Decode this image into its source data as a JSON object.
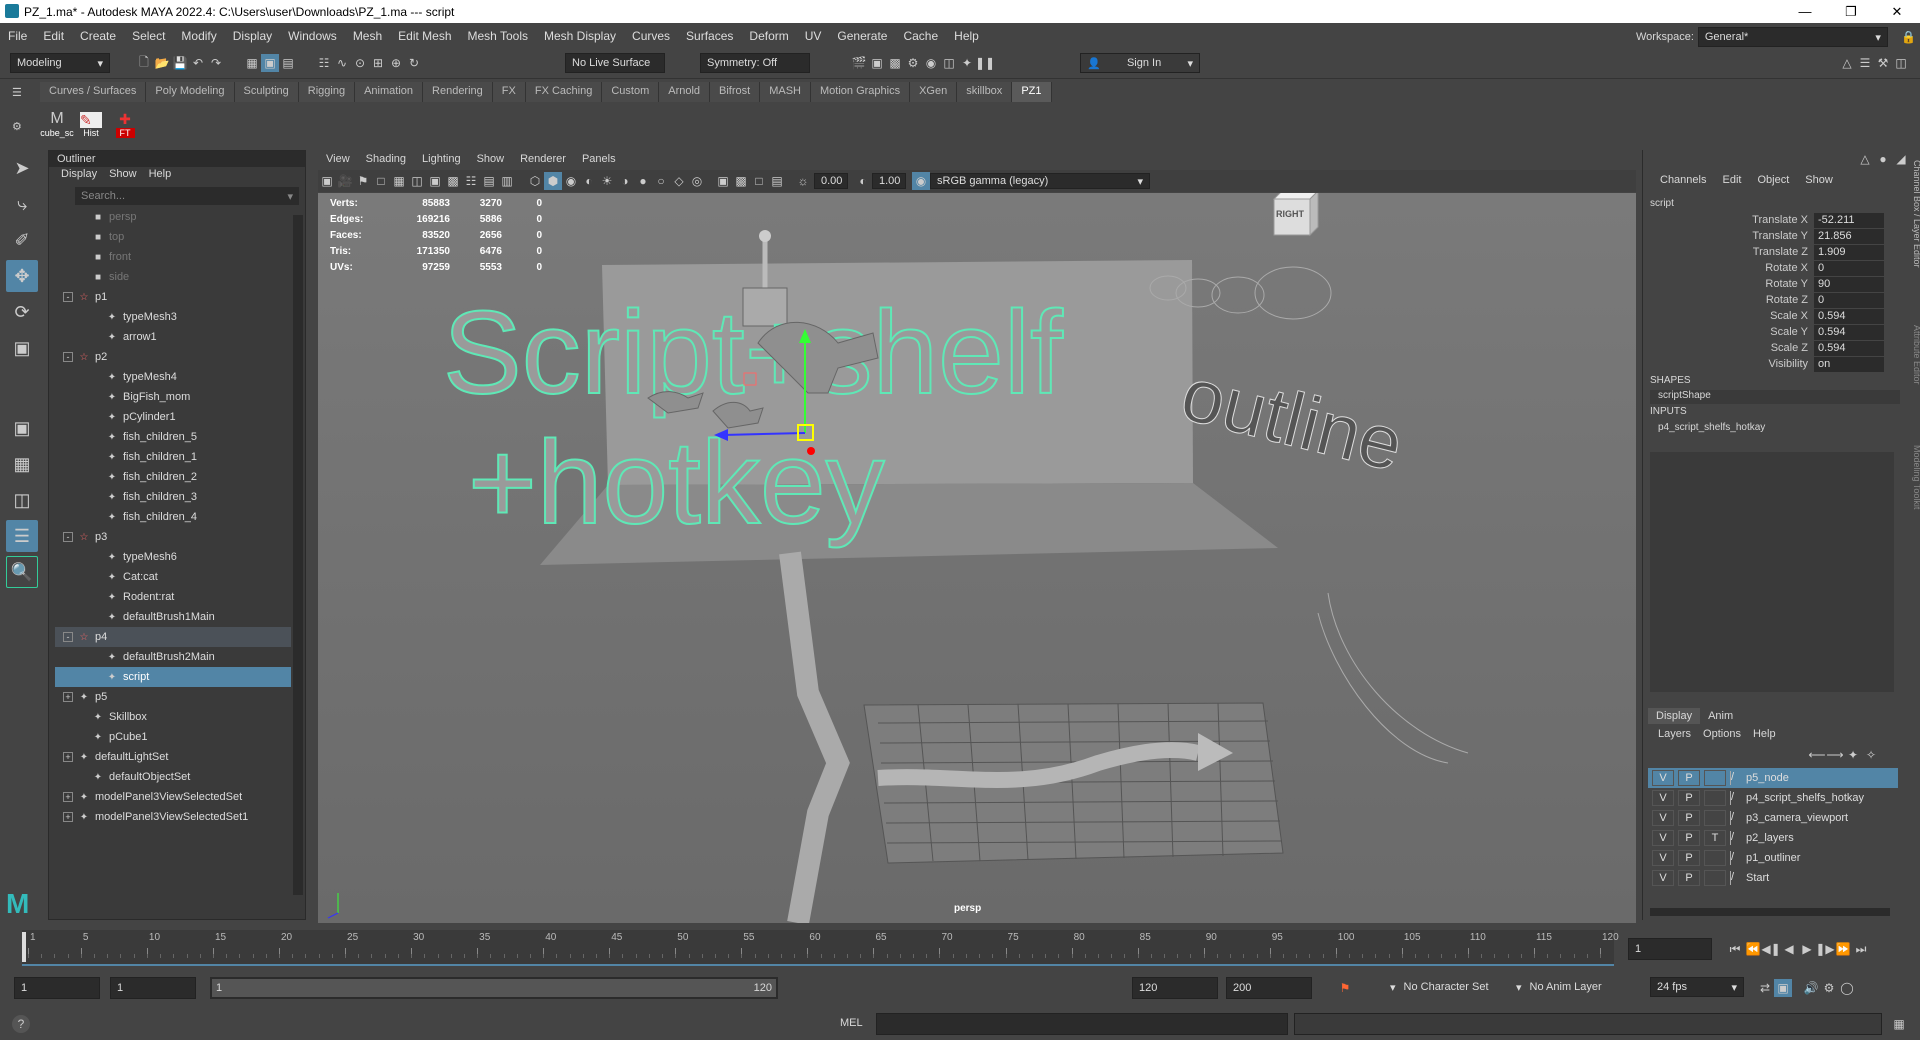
{
  "title": "PZ_1.ma* - Autodesk MAYA 2022.4: C:\\Users\\user\\Downloads\\PZ_1.ma  ---  script",
  "menus": [
    "File",
    "Edit",
    "Create",
    "Select",
    "Modify",
    "Display",
    "Windows",
    "Mesh",
    "Edit Mesh",
    "Mesh Tools",
    "Mesh Display",
    "Curves",
    "Surfaces",
    "Deform",
    "UV",
    "Generate",
    "Cache",
    "Help"
  ],
  "workspace_label": "Workspace:",
  "workspace_value": "General*",
  "status": {
    "mode": "Modeling",
    "live_surface": "No Live Surface",
    "symmetry": "Symmetry: Off",
    "sign_in": "Sign In"
  },
  "shelf_tabs": [
    "Curves / Surfaces",
    "Poly Modeling",
    "Sculpting",
    "Rigging",
    "Animation",
    "Rendering",
    "FX",
    "FX Caching",
    "Custom",
    "Arnold",
    "Bifrost",
    "MASH",
    "Motion Graphics",
    "XGen",
    "skillbox",
    "PZ1"
  ],
  "shelf_icons": [
    "cube_sc",
    "Hist",
    "FT"
  ],
  "outliner": {
    "title": "Outliner",
    "menu": [
      "Display",
      "Show",
      "Help"
    ],
    "search": "Search...",
    "items": [
      {
        "label": "persp",
        "indent": 1,
        "dim": true
      },
      {
        "label": "top",
        "indent": 1,
        "dim": true
      },
      {
        "label": "front",
        "indent": 1,
        "dim": true
      },
      {
        "label": "side",
        "indent": 1,
        "dim": true
      },
      {
        "label": "p1",
        "indent": 0,
        "exp": "-"
      },
      {
        "label": "typeMesh3",
        "indent": 2
      },
      {
        "label": "arrow1",
        "indent": 2
      },
      {
        "label": "p2",
        "indent": 0,
        "exp": "-"
      },
      {
        "label": "typeMesh4",
        "indent": 2
      },
      {
        "label": "BigFish_mom",
        "indent": 2
      },
      {
        "label": "pCylinder1",
        "indent": 2
      },
      {
        "label": "fish_children_5",
        "indent": 2
      },
      {
        "label": "fish_children_1",
        "indent": 2
      },
      {
        "label": "fish_children_2",
        "indent": 2
      },
      {
        "label": "fish_children_3",
        "indent": 2
      },
      {
        "label": "fish_children_4",
        "indent": 2
      },
      {
        "label": "p3",
        "indent": 0,
        "exp": "-"
      },
      {
        "label": "typeMesh6",
        "indent": 2
      },
      {
        "label": "Cat:cat",
        "indent": 2
      },
      {
        "label": "Rodent:rat",
        "indent": 2
      },
      {
        "label": "defaultBrush1Main",
        "indent": 2
      },
      {
        "label": "p4",
        "indent": 0,
        "exp": "-",
        "par": true
      },
      {
        "label": "defaultBrush2Main",
        "indent": 2
      },
      {
        "label": "script",
        "indent": 2,
        "sel": true
      },
      {
        "label": "p5",
        "indent": 0,
        "exp": "+"
      },
      {
        "label": "Skillbox",
        "indent": 1
      },
      {
        "label": "pCube1",
        "indent": 1
      },
      {
        "label": "defaultLightSet",
        "indent": 0,
        "exp": "+"
      },
      {
        "label": "defaultObjectSet",
        "indent": 1
      },
      {
        "label": "modelPanel3ViewSelectedSet",
        "indent": 0,
        "exp": "+"
      },
      {
        "label": "modelPanel3ViewSelectedSet1",
        "indent": 0,
        "exp": "+"
      }
    ]
  },
  "viewport": {
    "menu": [
      "View",
      "Shading",
      "Lighting",
      "Show",
      "Renderer",
      "Panels"
    ],
    "exposure": "0.00",
    "gamma": "1.00",
    "colorspace": "sRGB gamma (legacy)",
    "camera": "persp",
    "cube_label": "RIGHT",
    "hud": [
      {
        "k": "Verts:",
        "a": "85883",
        "b": "3270",
        "c": "0"
      },
      {
        "k": "Edges:",
        "a": "169216",
        "b": "5886",
        "c": "0"
      },
      {
        "k": "Faces:",
        "a": "83520",
        "b": "2656",
        "c": "0"
      },
      {
        "k": "Tris:",
        "a": "171350",
        "b": "6476",
        "c": "0"
      },
      {
        "k": "UVs:",
        "a": "97259",
        "b": "5553",
        "c": "0"
      }
    ],
    "text1": "Script+shelf",
    "text2": "+hotkey",
    "text3": "outline"
  },
  "channelbox": {
    "menu": [
      "Channels",
      "Edit",
      "Object",
      "Show"
    ],
    "object": "script",
    "attrs": [
      {
        "k": "Translate X",
        "v": "-52.211"
      },
      {
        "k": "Translate Y",
        "v": "21.856"
      },
      {
        "k": "Translate Z",
        "v": "1.909"
      },
      {
        "k": "Rotate X",
        "v": "0"
      },
      {
        "k": "Rotate Y",
        "v": "90"
      },
      {
        "k": "Rotate Z",
        "v": "0"
      },
      {
        "k": "Scale X",
        "v": "0.594"
      },
      {
        "k": "Scale Y",
        "v": "0.594"
      },
      {
        "k": "Scale Z",
        "v": "0.594"
      },
      {
        "k": "Visibility",
        "v": "on"
      }
    ],
    "shapes_hdr": "SHAPES",
    "shape": "scriptShape",
    "inputs_hdr": "INPUTS",
    "input": "p4_script_shelfs_hotkay",
    "side_tabs": [
      "Channel Box / Layer Editor",
      "Attribute Editor",
      "Modeling Toolkit"
    ]
  },
  "layers": {
    "tabs": [
      "Display",
      "Anim"
    ],
    "menu": [
      "Layers",
      "Options",
      "Help"
    ],
    "items": [
      {
        "v": "V",
        "p": "P",
        "t": "",
        "name": "p5_node",
        "sel": true
      },
      {
        "v": "V",
        "p": "P",
        "t": "",
        "name": "p4_script_shelfs_hotkay"
      },
      {
        "v": "V",
        "p": "P",
        "t": "",
        "name": "p3_camera_viewport"
      },
      {
        "v": "V",
        "p": "P",
        "t": "T",
        "name": "p2_layers"
      },
      {
        "v": "V",
        "p": "P",
        "t": "",
        "name": "p1_outliner"
      },
      {
        "v": "V",
        "p": "P",
        "t": "",
        "name": "Start"
      }
    ]
  },
  "timeline": {
    "ticks": [
      "1",
      "5",
      "10",
      "15",
      "20",
      "25",
      "30",
      "35",
      "40",
      "45",
      "50",
      "55",
      "60",
      "65",
      "70",
      "75",
      "80",
      "85",
      "90",
      "95",
      "100",
      "105",
      "110",
      "115",
      "120"
    ],
    "current": "1"
  },
  "range": {
    "start": "1",
    "start2": "1",
    "slider_start": "1",
    "slider_end": "120",
    "end": "120",
    "end2": "200",
    "character": "No Character Set",
    "anim_layer": "No Anim Layer",
    "fps": "24 fps"
  },
  "cmd": {
    "label": "MEL"
  }
}
